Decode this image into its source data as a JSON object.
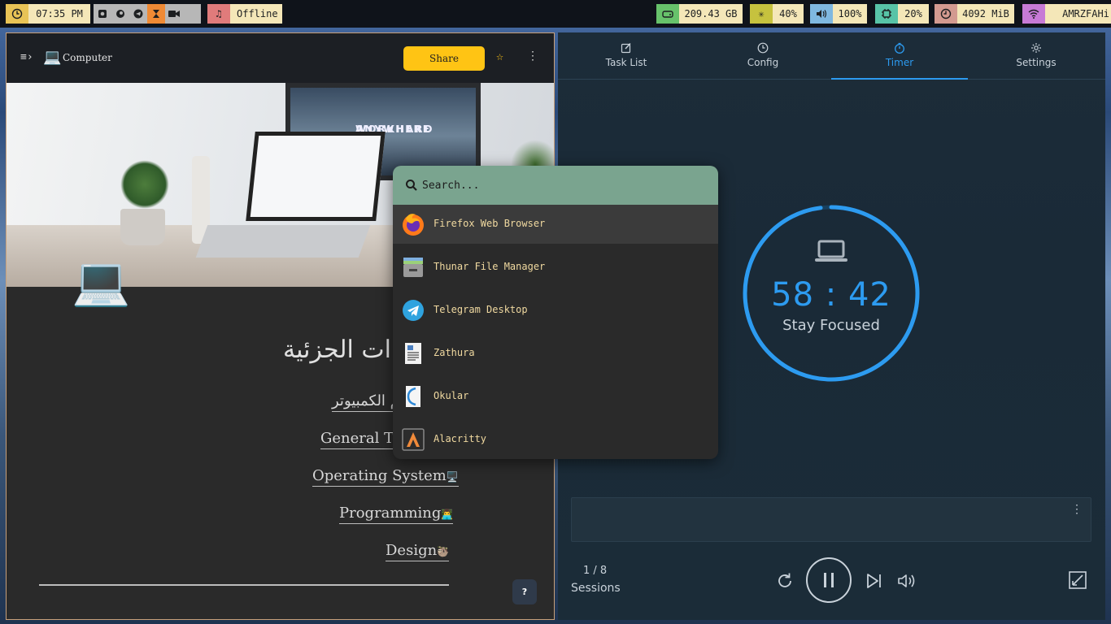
{
  "topbar": {
    "clock": {
      "icon": "clock-icon",
      "time": "07:35 PM"
    },
    "workspace_apps": [
      {
        "icon": "screenshot-icon"
      },
      {
        "icon": "firefox-icon"
      },
      {
        "icon": "telegram-icon"
      },
      {
        "icon": "hourglass-icon",
        "active": true
      },
      {
        "icon": "video-camera-icon"
      }
    ],
    "music": {
      "icon": "music-note-icon",
      "status": "Offline"
    },
    "disk": {
      "icon": "disk-icon",
      "value": "209.43 GB"
    },
    "cpu": {
      "icon": "cpu-load-icon",
      "value": "40%"
    },
    "volume": {
      "icon": "speaker-icon",
      "value": "100%"
    },
    "temperature": {
      "icon": "chip-icon",
      "value": "20%"
    },
    "memory": {
      "icon": "memory-icon",
      "value": "4092 MiB"
    },
    "network": {
      "icon": "wifi-icon",
      "value": "AMRZFAHi"
    },
    "colors": {
      "clock": "#e8c356",
      "active_workspace": "#ef8a35",
      "music": "#e07b7b",
      "disk": "#67c26b",
      "cpu": "#c6c23e",
      "volume": "#7fb8e0",
      "temp": "#58c3a7",
      "memory": "#d39a90",
      "network": "#c77ad6"
    }
  },
  "left_window": {
    "header": {
      "menu_icon": "menu-toggle-icon",
      "site_emoji": "💻",
      "site_title": "Computer",
      "share_label": "Share",
      "star_icon": "☆",
      "more_icon": "⋮"
    },
    "hero": {
      "monitor_text_1": "WORKHARD",
      "monitor_text_2": "ANYWHERE"
    },
    "page_emoji": "💻",
    "title": "ات الجزئية",
    "nav": [
      {
        "label": "لم الكمبيوتر",
        "emoji": ""
      },
      {
        "label": "General Tu",
        "emoji": ""
      },
      {
        "label": "Operating System",
        "emoji": "🖥️"
      },
      {
        "label": "Programming",
        "emoji": "👨‍💻"
      },
      {
        "label": "Design",
        "emoji": "🦥"
      }
    ],
    "help_label": "?"
  },
  "right_window": {
    "tabs": [
      {
        "label": "Task List",
        "icon": "edit-icon"
      },
      {
        "label": "Config",
        "icon": "clock-icon"
      },
      {
        "label": "Timer",
        "icon": "timer-icon",
        "active": true
      },
      {
        "label": "Settings",
        "icon": "gear-icon"
      }
    ],
    "timer": {
      "time": "58 : 42",
      "label": "Stay Focused",
      "progress": 0.98,
      "accent": "#2d9bf0"
    },
    "sessions": {
      "count": "1 / 8",
      "label": "Sessions"
    },
    "note_menu": "⋮"
  },
  "launcher": {
    "search_placeholder": "Search...",
    "apps": [
      {
        "name": "Firefox Web Browser",
        "icon": "firefox-icon",
        "selected": true
      },
      {
        "name": "Thunar File Manager",
        "icon": "file-manager-icon"
      },
      {
        "name": "Telegram Desktop",
        "icon": "telegram-icon"
      },
      {
        "name": "Zathura",
        "icon": "document-viewer-icon"
      },
      {
        "name": "Okular",
        "icon": "okular-icon"
      },
      {
        "name": "Alacritty",
        "icon": "terminal-icon"
      }
    ],
    "colors": {
      "search_bg": "#7aa48f",
      "text": "#f0d9a0"
    }
  }
}
